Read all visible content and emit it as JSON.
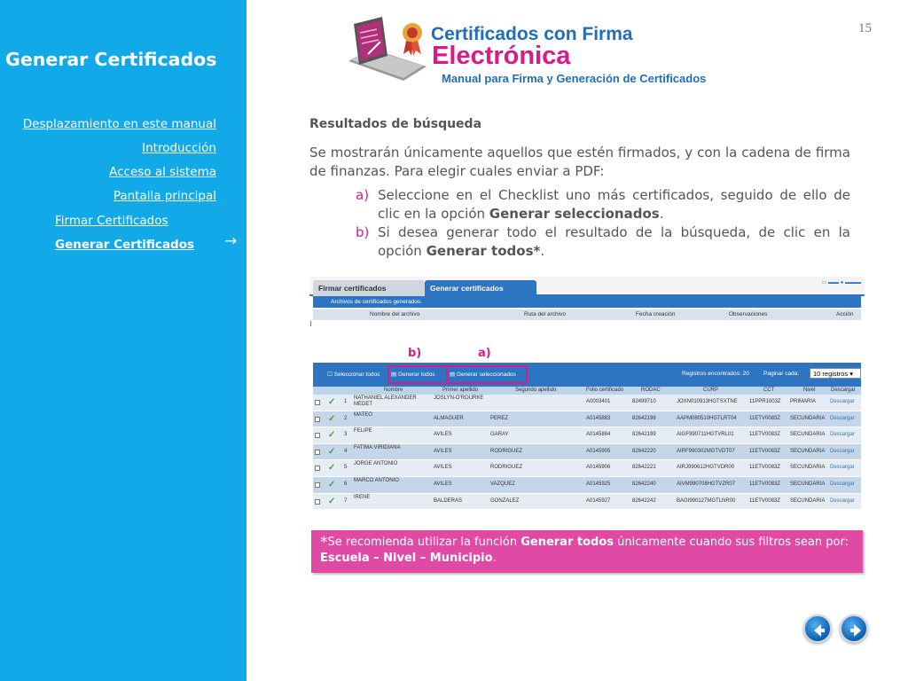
{
  "sidebar": {
    "title": "Generar Certificados",
    "nav": [
      "Desplazamiento en este manual",
      "Introducción",
      "Acceso al sistema",
      "Pantalla principal"
    ],
    "sub": [
      "Firmar Certificados",
      "Generar Certificados"
    ],
    "arrow": "→"
  },
  "header": {
    "page_number": "15",
    "title_line1": "Certificados con Firma",
    "title_line2": "Electrónica",
    "subtitle": "Manual para Firma y Generación de Certificados"
  },
  "content": {
    "section_title": "Resultados de búsqueda",
    "paragraph": "Se mostrarán únicamente aquellos que estén firmados, y con la cadena de firma de finanzas. Para elegir cuales enviar a PDF:",
    "items": [
      {
        "letter": "a)",
        "pre": "Seleccione en el Checklist uno más certificados, seguido de ello de clic en la opción ",
        "bold": "Generar seleccionados",
        "post": "."
      },
      {
        "letter": "b)",
        "pre": "Si desea generar todo el resultado de la búsqueda, de clic en la opción ",
        "bold": "Generar todos*",
        "post": "."
      }
    ]
  },
  "screenshot": {
    "tabs": [
      "Firmar certificados",
      "Generar certificados"
    ],
    "bar1_title": "Archivos de certificados generados.",
    "hdr1": [
      "Nombre del archivo",
      "Ruta del archivo",
      "Fecha creación",
      "Observaciones",
      "Acción"
    ],
    "label_b": "b)",
    "label_a": "a)",
    "toolbar": {
      "select_all": "Seleccionar todos",
      "gen_all": "Generar todos",
      "gen_selected": "Generar seleccionados",
      "found": "Registros encontrados: 20",
      "per_page": "Paginar cada:",
      "per_page_value": "10 registros ▾"
    },
    "columns": [
      "Nombre",
      "Primer apellido",
      "Segundo apellido",
      "Folio certificado",
      "RODAC",
      "CURP",
      "CCT",
      "Nivel",
      "Descargar"
    ],
    "rows": [
      {
        "n": "1",
        "nombre": "NATHANIEL ALEXANDER MEDET",
        "ap1": "JOSLYN-O'ROURKE",
        "ap2": "",
        "folio": "A0003401",
        "rodac": "82499710",
        "curp": "JOXN010913HGTSXTNE",
        "cct": "11PPR1003Z",
        "nivel": "PRIMARIA",
        "desc": "Descargar"
      },
      {
        "n": "2",
        "nombre": "MATEO",
        "ap1": "ALMAGUER",
        "ap2": "PEREZ",
        "folio": "A0145883",
        "rodac": "82642198",
        "curp": "AAPM080510HGTLRT04",
        "cct": "11ETV0083Z",
        "nivel": "SECUNDARIA",
        "desc": "Descargar"
      },
      {
        "n": "3",
        "nombre": "FELIPE",
        "ap1": "AVILES",
        "ap2": "GARAY",
        "folio": "A0145884",
        "rodac": "82642199",
        "curp": "AIGF990711HGTVRL01",
        "cct": "11ETV0083Z",
        "nivel": "SECUNDARIA",
        "desc": "Descargar"
      },
      {
        "n": "4",
        "nombre": "FATIMA VIRIDIANA",
        "ap1": "AVILES",
        "ap2": "RODRIGUEZ",
        "folio": "A0145905",
        "rodac": "82642220",
        "curp": "AIRF990302MGTVDT07",
        "cct": "11ETV0083Z",
        "nivel": "SECUNDARIA",
        "desc": "Descargar"
      },
      {
        "n": "5",
        "nombre": "JORGE ANTONIO",
        "ap1": "AVILES",
        "ap2": "RODRIGUEZ",
        "folio": "A0145906",
        "rodac": "82642221",
        "curp": "AIRJ990612HGTVDR00",
        "cct": "11ETV0083Z",
        "nivel": "SECUNDARIA",
        "desc": "Descargar"
      },
      {
        "n": "6",
        "nombre": "MARCO ANTONIO",
        "ap1": "AVILES",
        "ap2": "VAZQUEZ",
        "folio": "A0145925",
        "rodac": "82642240",
        "curp": "AIVM990708HGTVZR07",
        "cct": "11ETV0083Z",
        "nivel": "SECUNDARIA",
        "desc": "Descargar"
      },
      {
        "n": "7",
        "nombre": "IRENE",
        "ap1": "BALDERAS",
        "ap2": "GONZALEZ",
        "folio": "A0145927",
        "rodac": "82642242",
        "curp": "BAGI990127MGTLNR00",
        "cct": "11ETV0083Z",
        "nivel": "SECUNDARIA",
        "desc": "Descargar"
      }
    ]
  },
  "note": {
    "star": "*",
    "pre": "Se recomienda utilizar la función ",
    "bold1": "Generar todos",
    "mid": "  únicamente cuando sus filtros sean por: ",
    "bold2": "Escuela – Nivel – Municipio",
    "post": "."
  },
  "colors": {
    "sidebar": "#12A9E8",
    "magenta": "#D81B89",
    "blue": "#1F6FB8",
    "note_bg": "#E04AA5"
  }
}
